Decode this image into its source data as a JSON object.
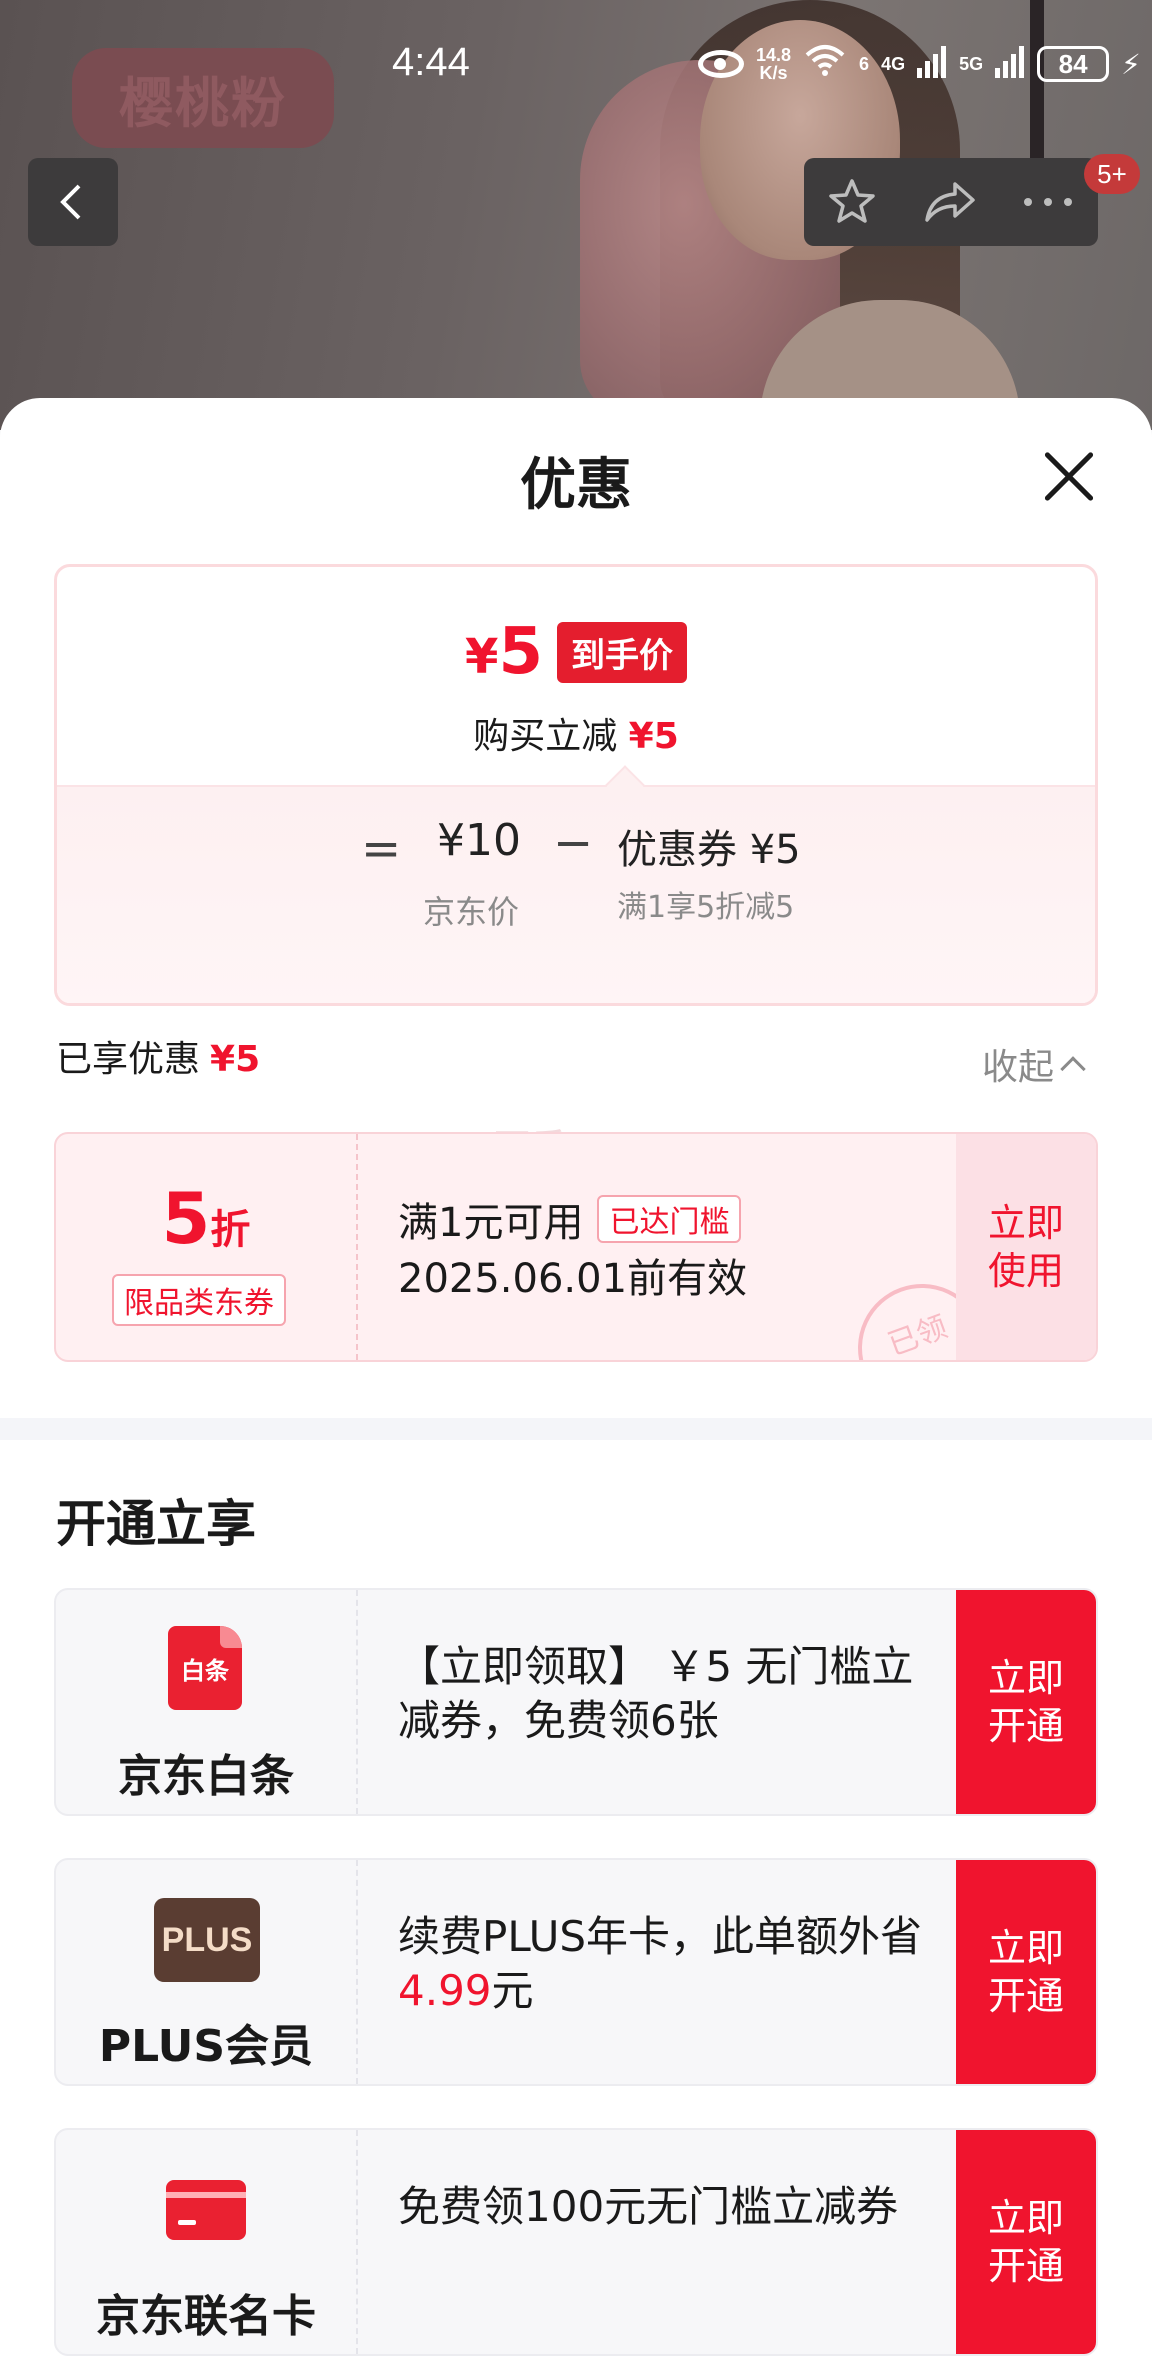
{
  "background": {
    "product_tag": "樱桃粉"
  },
  "status_bar": {
    "time": "4:44",
    "net_speed_value": "14.8",
    "net_speed_unit": "K/s",
    "wifi_label": "6",
    "sig1_label": "4G",
    "sig2_label": "5G",
    "battery": "84"
  },
  "nav": {
    "notification_badge": "5+"
  },
  "sheet": {
    "title": "优惠",
    "price": {
      "yen": "¥",
      "amount": "5",
      "tag": "到手价",
      "sub_label": "购买立减",
      "sub_value": "¥5",
      "equals": "=",
      "jd_price": "¥10",
      "jd_price_label": "京东价",
      "minus": "−",
      "coupon_value": "优惠券 ¥5",
      "coupon_desc": "满1享5折减5"
    },
    "enjoyed_label": "已享优惠",
    "enjoyed_value": "¥5",
    "collapse_label": "收起",
    "watermark": "可乐-",
    "coupon": {
      "discount": "5",
      "discount_unit": "折",
      "category": "限品类东券",
      "condition": "满1元可用",
      "reached": "已达门槛",
      "valid_until": "2025.06.01前有效",
      "use_label": "立即使用",
      "stamp": "已领"
    },
    "section_title": "开通立享",
    "services": [
      {
        "icon_text": "白条",
        "name": "京东白条",
        "desc": "【立即领取】 ￥5 无门槛立减券，免费领6张",
        "button": "立即开通"
      },
      {
        "icon_text": "PLUS",
        "name": "PLUS会员",
        "desc_pre": "续费PLUS年卡，此单额外省",
        "desc_red": "4.99",
        "desc_post": "元",
        "button": "立即开通"
      },
      {
        "icon_text": "",
        "name": "京东联名卡",
        "desc": "免费领100元无门槛立减券",
        "button": "立即开通"
      }
    ]
  },
  "colors": {
    "accent_red": "#f0142e",
    "plus_brown": "#5a3d32"
  }
}
